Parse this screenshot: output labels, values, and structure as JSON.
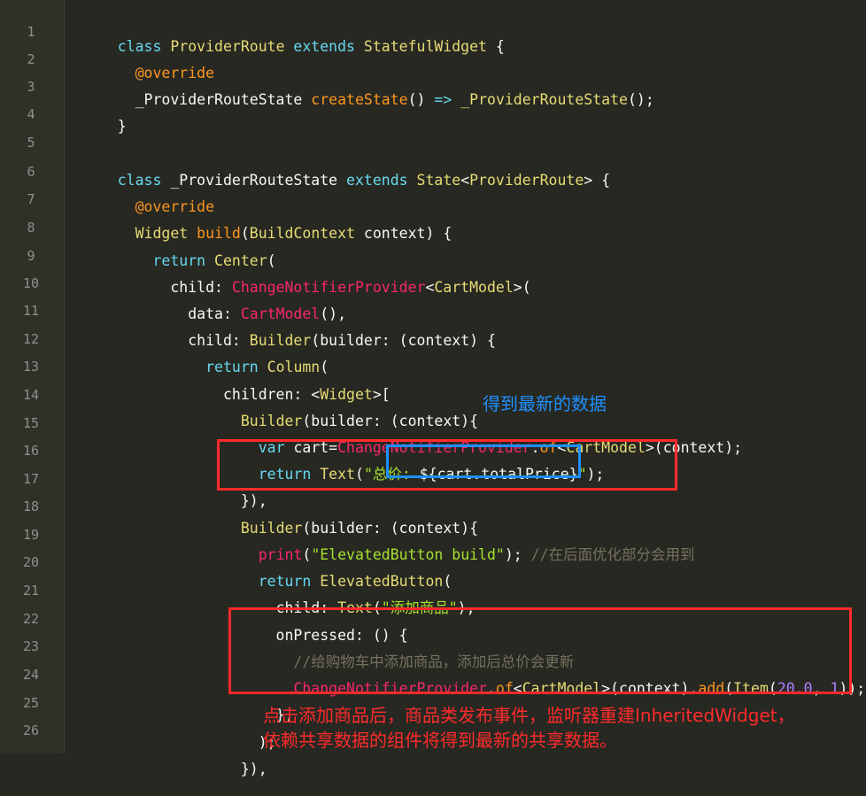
{
  "gutter": {
    "line_numbers": [
      "1",
      "2",
      "3",
      "4",
      "5",
      "6",
      "7",
      "8",
      "9",
      "10",
      "11",
      "12",
      "13",
      "14",
      "15",
      "16",
      "17",
      "18",
      "19",
      "20",
      "21",
      "22",
      "23",
      "24",
      "25",
      "26"
    ]
  },
  "code": {
    "l1": [
      "class ",
      "ProviderRoute",
      " extends ",
      "StatefulWidget",
      " {"
    ],
    "l2": [
      "  ",
      "@override"
    ],
    "l3": [
      "  _ProviderRouteState ",
      "createState",
      "() ",
      "=>",
      " ",
      "_ProviderRouteState",
      "();"
    ],
    "l4": [
      "}"
    ],
    "l6": [
      "class ",
      "_ProviderRouteState",
      " extends ",
      "State",
      "<",
      "ProviderRoute",
      "> {"
    ],
    "l7": [
      "  ",
      "@override"
    ],
    "l8": [
      "  ",
      "Widget",
      " ",
      "build",
      "(",
      "BuildContext",
      " context) {"
    ],
    "l9": [
      "    ",
      "return",
      " ",
      "Center",
      "("
    ],
    "l10": [
      "      child: ",
      "ChangeNotifierProvider",
      "<",
      "CartModel",
      ">("
    ],
    "l11": [
      "        data: ",
      "CartModel",
      "(),"
    ],
    "l12": [
      "        child: ",
      "Builder",
      "(builder: (context) {"
    ],
    "l13": [
      "          ",
      "return",
      " ",
      "Column",
      "("
    ],
    "l14": [
      "            children: <",
      "Widget",
      ">["
    ],
    "l15": [
      "              ",
      "Builder",
      "(builder: (context){"
    ],
    "l16": [
      "                ",
      "var",
      " cart=",
      "ChangeNotifierProvider",
      ".",
      "of",
      "<",
      "CartModel",
      ">(context);"
    ],
    "l17": [
      "                ",
      "return",
      " ",
      "Text",
      "(",
      "\"总价: ",
      "${cart.totalPrice}",
      "\"",
      ");"
    ],
    "l18": [
      "              }),"
    ],
    "l19": [
      "              ",
      "Builder",
      "(builder: (context){"
    ],
    "l20": [
      "                ",
      "print",
      "(",
      "\"ElevatedButton build\"",
      "); ",
      "//在后面优化部分会用到"
    ],
    "l21": [
      "                ",
      "return",
      " ",
      "ElevatedButton",
      "("
    ],
    "l22": [
      "                  child: ",
      "Text",
      "(",
      "\"添加商品\"",
      "),"
    ],
    "l23": [
      "                  onPressed: () {"
    ],
    "l24": [
      "                    ",
      "//给购物车中添加商品，添加后总价会更新"
    ],
    "l25": [
      "                    ",
      "ChangeNotifierProvider",
      ".",
      "of",
      "<",
      "CartModel",
      ">(context).",
      "add",
      "(",
      "Item",
      "(",
      "20.0",
      ", ",
      "1",
      "));"
    ],
    "l26": [
      "                  },"
    ],
    "l27": [
      "                );"
    ],
    "l28": [
      "              }),"
    ]
  },
  "annotations": {
    "blue_note": "得到最新的数据",
    "red_note_line1": "点击添加商品后，商品类发布事件，监听器重建InheritedWidget，",
    "red_note_line2": "依赖共享数据的组件将得到最新的共享数据。"
  },
  "colors": {
    "background": "#272822",
    "gutter": "#2f3129",
    "keyword": "#66d9ef",
    "type": "#e6db74",
    "string": "#a6e22e",
    "number": "#ae81ff",
    "comment": "#75715e",
    "annotation": "#fd971f",
    "red_box": "#ff2b2b",
    "blue_box": "#1e90ff"
  }
}
